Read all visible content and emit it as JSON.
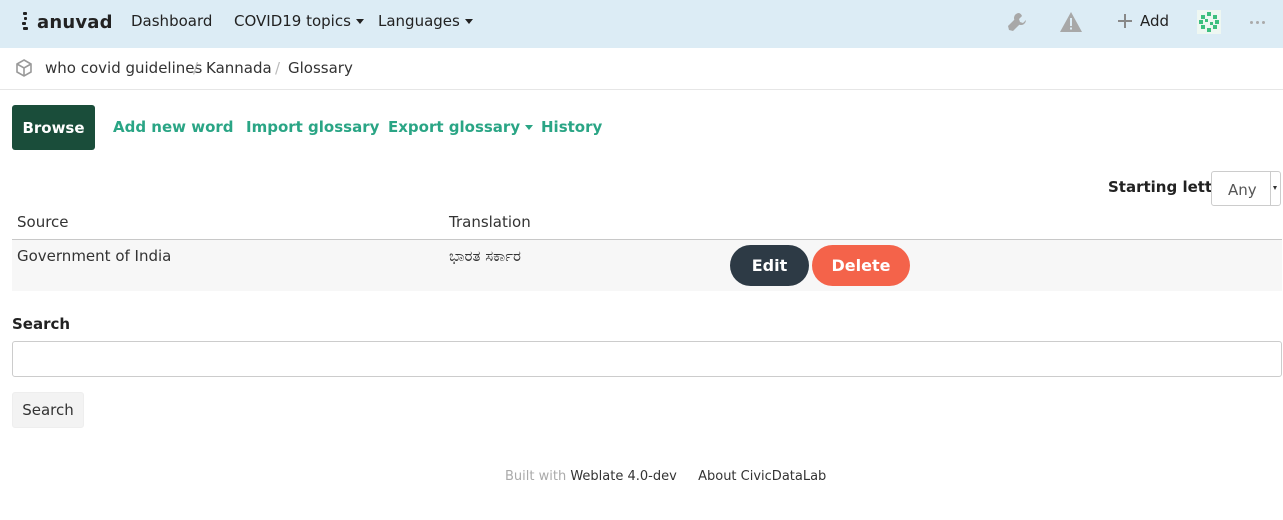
{
  "navbar": {
    "brand": "anuvad",
    "links": {
      "dashboard": "Dashboard",
      "covid_topics": "COVID19 topics",
      "languages": "Languages"
    },
    "icons": [
      "wrench-icon",
      "warning-icon",
      "plus-icon",
      "avatar",
      "more-icon"
    ],
    "add_label": "Add"
  },
  "breadcrumb": {
    "icon": "cube-icon",
    "project": "who covid guidelines",
    "language": "Kannada",
    "page": "Glossary",
    "separator": "/"
  },
  "tabs": {
    "browse": "Browse",
    "add_new_word": "Add new word",
    "import_glossary": "Import glossary",
    "export_glossary": "Export glossary",
    "history": "History"
  },
  "filter": {
    "label": "Starting letter",
    "value": "Any"
  },
  "table": {
    "headers": {
      "source": "Source",
      "translation": "Translation"
    },
    "rows": [
      {
        "source": "Government of India",
        "translation": "ಭಾರತ ಸರ್ಕಾರ",
        "edit": "Edit",
        "delete": "Delete"
      }
    ]
  },
  "search": {
    "label": "Search",
    "value": "",
    "button": "Search"
  },
  "footer": {
    "built_with": "Built with",
    "weblate": "Weblate 4.0-dev",
    "about": "About CivicDataLab"
  },
  "colors": {
    "navbar_bg": "#dcecf5",
    "primary_dark": "#1a4d3a",
    "link_green": "#2aa585",
    "edit_bg": "#2d3a45",
    "delete_bg": "#f4634a"
  }
}
